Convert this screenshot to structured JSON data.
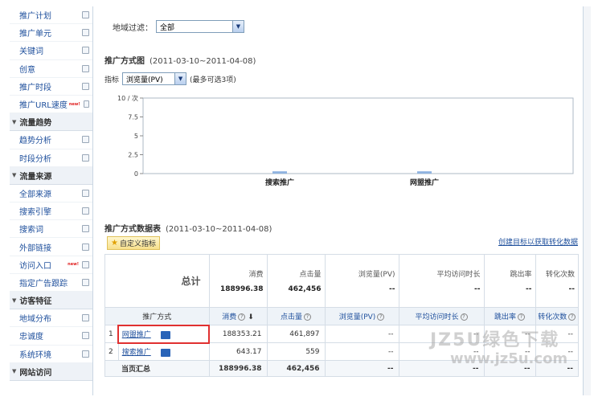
{
  "sidebar": {
    "items": [
      {
        "type": "item",
        "label": "推广计划"
      },
      {
        "type": "item",
        "label": "推广单元"
      },
      {
        "type": "item",
        "label": "关键词"
      },
      {
        "type": "item",
        "label": "创意"
      },
      {
        "type": "item",
        "label": "推广时段"
      },
      {
        "type": "item",
        "label": "推广URL速度",
        "badge": "new!"
      },
      {
        "type": "head",
        "label": "流量趋势"
      },
      {
        "type": "item",
        "label": "趋势分析"
      },
      {
        "type": "item",
        "label": "时段分析"
      },
      {
        "type": "head",
        "label": "流量来源"
      },
      {
        "type": "item",
        "label": "全部来源"
      },
      {
        "type": "item",
        "label": "搜索引擎"
      },
      {
        "type": "item",
        "label": "搜索词"
      },
      {
        "type": "item",
        "label": "外部链接"
      },
      {
        "type": "item",
        "label": "访问入口",
        "badge": "new!"
      },
      {
        "type": "item",
        "label": "指定广告跟踪"
      },
      {
        "type": "head",
        "label": "访客特征"
      },
      {
        "type": "item",
        "label": "地域分布"
      },
      {
        "type": "item",
        "label": "忠诚度"
      },
      {
        "type": "item",
        "label": "系统环境"
      },
      {
        "type": "head",
        "label": "网站访问"
      }
    ]
  },
  "filter": {
    "label": "地域过滤：",
    "value": "全部"
  },
  "chart_section": {
    "title": "推广方式图",
    "range": "(2011-03-10~2011-04-08)"
  },
  "metric": {
    "label": "指标",
    "value": "浏览量(PV)",
    "hint": "(最多可选3项)"
  },
  "chart_data": {
    "type": "bar",
    "categories": [
      "搜索推广",
      "网盟推广"
    ],
    "values": [
      0.3,
      0.3
    ],
    "yunit": "10 / 次",
    "ylim": [
      0,
      10
    ],
    "yticks": [
      "10 / 次",
      "7.5",
      "5",
      "2.5",
      "0"
    ]
  },
  "table_section": {
    "title": "推广方式数据表",
    "range": "(2011-03-10~2011-04-08)"
  },
  "custom_button": "自定义指标",
  "create_link": "创建目标以获取转化数据",
  "summary": {
    "label": "总计",
    "columns": [
      {
        "header": "消费",
        "value": "188996.38"
      },
      {
        "header": "点击量",
        "value": "462,456"
      },
      {
        "header": "浏览量(PV)",
        "value": "--"
      },
      {
        "header": "平均访问时长",
        "value": "--"
      },
      {
        "header": "跳出率",
        "value": "--"
      },
      {
        "header": "转化次数",
        "value": "--"
      }
    ]
  },
  "table_headers": [
    "推广方式",
    "消费",
    "点击量",
    "浏览量(PV)",
    "平均访问时长",
    "跳出率",
    "转化次数"
  ],
  "rows": [
    {
      "idx": "1",
      "name": "网盟推广",
      "cost": "188353.21",
      "clicks": "461,897",
      "pv": "--",
      "avg": "--",
      "bounce": "--",
      "conv": "--"
    },
    {
      "idx": "2",
      "name": "搜索推广",
      "cost": "643.17",
      "clicks": "559",
      "pv": "--",
      "avg": "--",
      "bounce": "--",
      "conv": "--"
    }
  ],
  "footer": {
    "label": "当页汇总",
    "cost": "188996.38",
    "clicks": "462,456",
    "pv": "--",
    "avg": "--",
    "bounce": "--",
    "conv": "--"
  },
  "watermark": {
    "text": "JZ5U绿色下载",
    "url": "www.jz5u.com"
  }
}
